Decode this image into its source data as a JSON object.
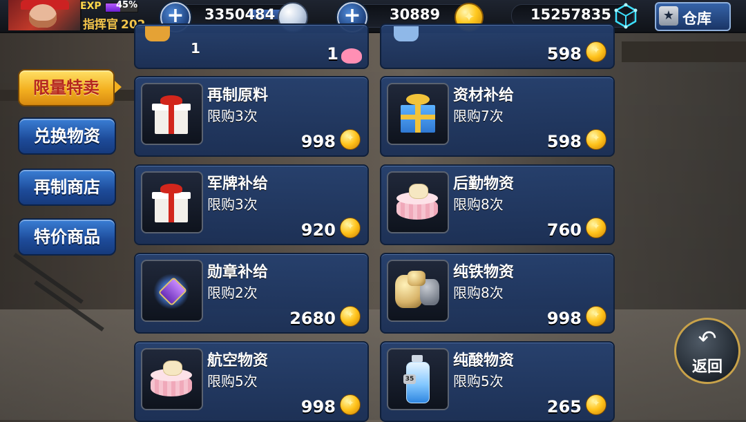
{
  "header": {
    "exp_label": "EXP",
    "exp_percent": "45%",
    "exp_fraction": 0.45,
    "rank_label": "指挥官",
    "level": "202",
    "silver": "3350484",
    "gold": "30889",
    "crystal": "15257835",
    "warehouse_label": "仓库",
    "plus_symbol": "+"
  },
  "tabs": [
    {
      "label": "限量特卖",
      "active": true
    },
    {
      "label": "兑换物资",
      "active": false
    },
    {
      "label": "再制商店",
      "active": false
    },
    {
      "label": "特价商品",
      "active": false
    }
  ],
  "partial_row": {
    "left": {
      "count": "1",
      "qty": "1"
    },
    "right": {
      "price": "598"
    }
  },
  "items": [
    {
      "name": "再制原料",
      "limit": "限购3次",
      "price": "998",
      "icon": "red-gift-box-icon"
    },
    {
      "name": "资材补给",
      "limit": "限购7次",
      "price": "598",
      "icon": "blue-gift-box-icon"
    },
    {
      "name": "军牌补给",
      "limit": "限购3次",
      "price": "920",
      "icon": "red-gift-box-icon"
    },
    {
      "name": "后勤物资",
      "limit": "限购8次",
      "price": "760",
      "icon": "pink-cake-box-icon"
    },
    {
      "name": "勋章补给",
      "limit": "限购2次",
      "price": "2680",
      "icon": "heart-medal-icon"
    },
    {
      "name": "纯铁物资",
      "limit": "限购8次",
      "price": "998",
      "icon": "iron-ore-icon"
    },
    {
      "name": "航空物资",
      "limit": "限购5次",
      "price": "998",
      "icon": "pink-cake-box-icon"
    },
    {
      "name": "纯酸物资",
      "limit": "限购5次",
      "price": "265",
      "icon": "acid-vial-icon"
    }
  ],
  "vial_tag": "35",
  "back_button": {
    "arrow": "↶",
    "label": "返回"
  },
  "colors": {
    "gold_accent": "#ffc21a",
    "card_blue": "#243f6e",
    "active_tab": "#f3b020"
  }
}
